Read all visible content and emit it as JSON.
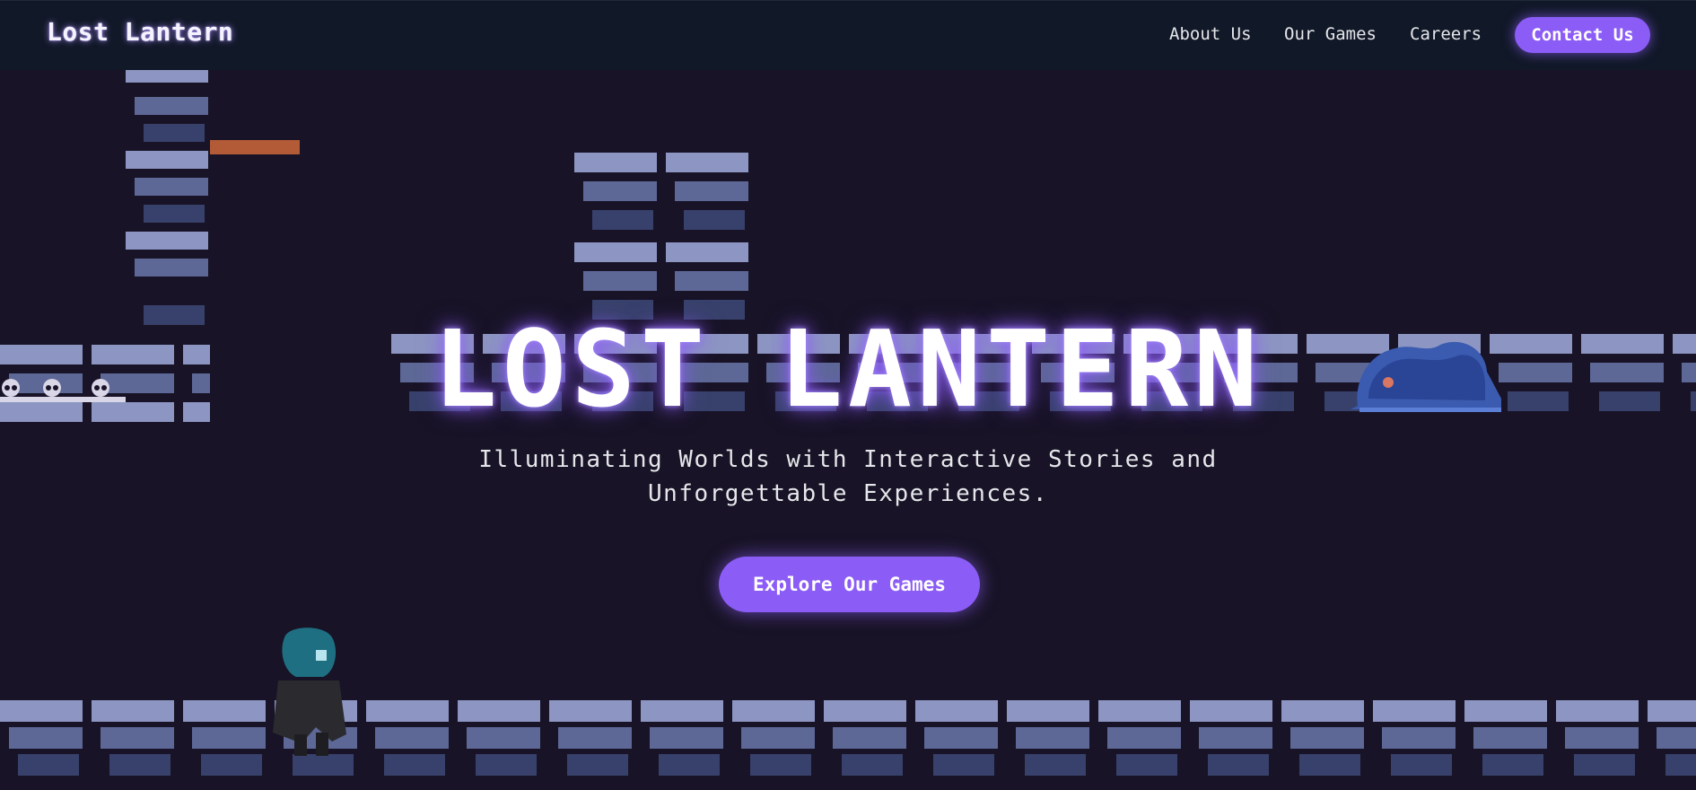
{
  "nav": {
    "brand": "Lost Lantern",
    "links": [
      "About Us",
      "Our Games",
      "Careers"
    ],
    "contact_label": "Contact Us"
  },
  "hero": {
    "title": "LOST LANTERN",
    "subtitle_line1": "Illuminating Worlds with Interactive Stories and",
    "subtitle_line2": "Unforgettable Experiences.",
    "cta_label": "Explore Our Games"
  },
  "colors": {
    "accent": "#8b5cf6",
    "nav_bg": "#111827",
    "page_bg": "#181326",
    "brick_light": "#8d96c2",
    "brick_mid": "#5d6896",
    "brick_dark": "#38416b"
  },
  "icons": [
    "hooded-character-sprite",
    "slime-sprite",
    "skull-icons"
  ]
}
